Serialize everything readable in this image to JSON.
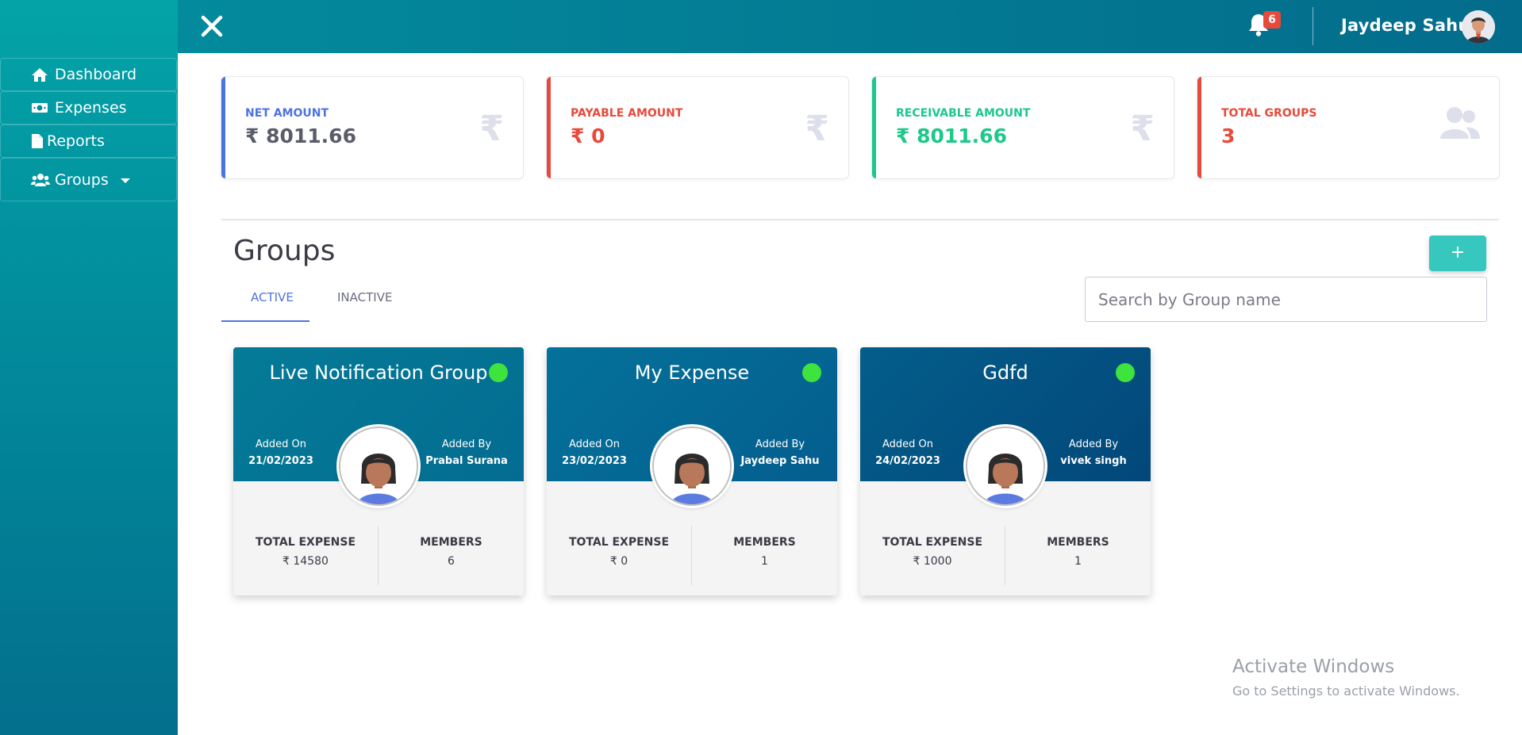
{
  "header": {
    "user_name": "Jaydeep Sahu",
    "notification_count": "6"
  },
  "sidebar": {
    "items": [
      {
        "label": "Dashboard",
        "icon": "home-icon"
      },
      {
        "label": "Expenses",
        "icon": "money-icon"
      },
      {
        "label": "Reports",
        "icon": "file-icon"
      },
      {
        "label": "Groups",
        "icon": "users-icon"
      }
    ]
  },
  "stats": [
    {
      "label": "NET AMOUNT",
      "value": "₹ 8011.66",
      "color": "#4e73df",
      "value_color": "#5a5c69",
      "icon": "rupee-icon"
    },
    {
      "label": "PAYABLE AMOUNT",
      "value": "₹ 0",
      "color": "#e74a3b",
      "value_color": "#e74a3b",
      "icon": "rupee-icon"
    },
    {
      "label": "RECEIVABLE AMOUNT",
      "value": "₹ 8011.66",
      "color": "#1cc88a",
      "value_color": "#1cc88a",
      "icon": "rupee-icon"
    },
    {
      "label": "TOTAL GROUPS",
      "value": "3",
      "color": "#e74a3b",
      "value_color": "#e74a3b",
      "icon": "users-icon"
    }
  ],
  "groups_section": {
    "title": "Groups",
    "add_label": "+",
    "tabs": [
      "ACTIVE",
      "INACTIVE"
    ],
    "active_tab": "ACTIVE",
    "search_placeholder": "Search by Group name"
  },
  "groups": [
    {
      "name": "Live Notification Group",
      "added_on_label": "Added On",
      "added_on": "21/02/2023",
      "added_by_label": "Added By",
      "added_by": "Prabal Surana",
      "expense_label": "TOTAL EXPENSE",
      "expense": "₹ 14580",
      "members_label": "MEMBERS",
      "members": "6",
      "status_color": "#3ee33e"
    },
    {
      "name": "My Expense",
      "added_on_label": "Added On",
      "added_on": "23/02/2023",
      "added_by_label": "Added By",
      "added_by": "Jaydeep Sahu",
      "expense_label": "TOTAL EXPENSE",
      "expense": "₹ 0",
      "members_label": "MEMBERS",
      "members": "1",
      "status_color": "#3ee33e"
    },
    {
      "name": "Gdfd",
      "added_on_label": "Added On",
      "added_on": "24/02/2023",
      "added_by_label": "Added By",
      "added_by": "vivek singh",
      "expense_label": "TOTAL EXPENSE",
      "expense": "₹ 1000",
      "members_label": "MEMBERS",
      "members": "1",
      "status_color": "#3ee33e"
    }
  ],
  "watermark": {
    "line1": "Activate Windows",
    "line2": "Go to Settings to activate Windows."
  }
}
